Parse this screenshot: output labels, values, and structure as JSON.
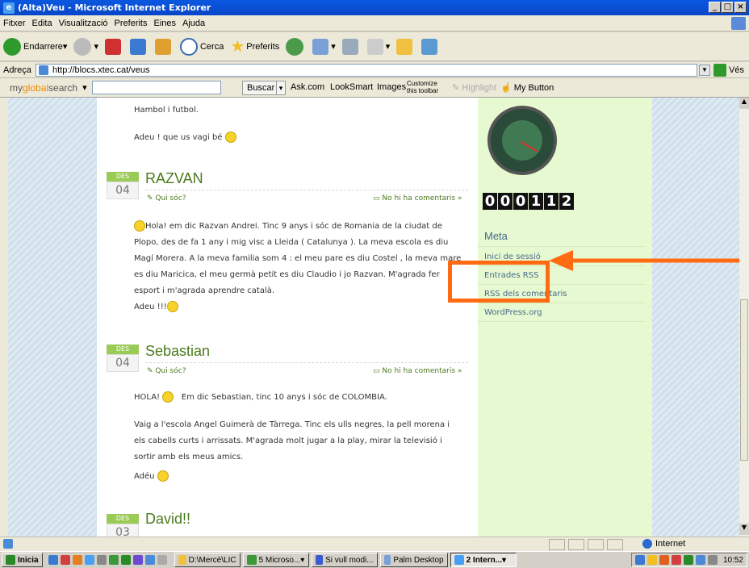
{
  "window": {
    "title": "(Alta)Veu - Microsoft Internet Explorer",
    "controls": [
      "_",
      "□",
      "×"
    ]
  },
  "menu": [
    "Fitxer",
    "Edita",
    "Visualització",
    "Preferits",
    "Eines",
    "Ajuda"
  ],
  "toolbar": {
    "back_label": "Endarrere",
    "search_label": "Cerca",
    "favorites_label": "Preferits"
  },
  "address": {
    "label": "Adreça",
    "url": "http://blocs.xtec.cat/veus",
    "go_label": "Vés"
  },
  "searchbar": {
    "brand_prefix": "my",
    "brand_highlight": "global",
    "brand_suffix": "search",
    "buscar": "Buscar",
    "links": [
      "Ask.com",
      "LookSmart",
      "Images"
    ],
    "customize_line1": "Customize",
    "customize_line2": "this toolbar",
    "highlight": "Highlight",
    "mybutton": "My Button"
  },
  "posts": {
    "top": {
      "line1": "Hambol i futbol.",
      "line2": "Adeu ! que us vagi bé"
    },
    "razvan": {
      "month": "DES",
      "day": "04",
      "title": "RAZVAN",
      "author_link": "Qui sóc?",
      "comments": "No hi ha comentaris »",
      "body": [
        "Hola! em dic Razvan Andrei. Tinc 9 anys i sóc de Romania de la ciudat de",
        "Plopo, des de fa 1 any i mig visc a Lleida ( Catalunya ). La meva escola es diu",
        "Magí Morera. A la meva familia som 4 : el meu pare es diu Costel , la meva mare",
        "es diu Maricica, el meu germà petit es diu Claudio i jo Razvan.  M'agrada fer",
        "esport i m'agrada aprendre català."
      ],
      "farewell": "Adeu !!!"
    },
    "sebastian": {
      "month": "DES",
      "day": "04",
      "title": "Sebastian",
      "author_link": "Qui sóc?",
      "comments": "No hi ha comentaris »",
      "hello": "HOLA!",
      "intro": "Em dic Sebastian, tinc 10 anys i sóc de COLOMBIA.",
      "body": [
        "Vaig a l'escola Angel Guimerà de Tàrrega. Tinc els ulls negres, la pell morena i",
        "els cabells curts i arrissats. M'agrada molt jugar a la play, mirar la televisió i",
        "sortir amb els meus amics."
      ],
      "farewell": "Adéu"
    },
    "david": {
      "month": "DES",
      "day": "03",
      "title": "David!!"
    }
  },
  "sidebar": {
    "counter": [
      "0",
      "0",
      "0",
      "1",
      "1",
      "2"
    ],
    "meta_title": "Meta",
    "items": [
      "Inici de sessió",
      "Entrades RSS",
      "RSS dels comentaris",
      "WordPress.org"
    ]
  },
  "statusbar": {
    "zone": "Internet"
  },
  "taskbar": {
    "start": "Inicia",
    "tasks": [
      "D:\\Mercè\\LIC",
      "5 Microso...",
      "Si vull modi...",
      "Palm Desktop",
      "2 Intern..."
    ],
    "clock": "10:52"
  },
  "annotation_color": "#ff6a13"
}
